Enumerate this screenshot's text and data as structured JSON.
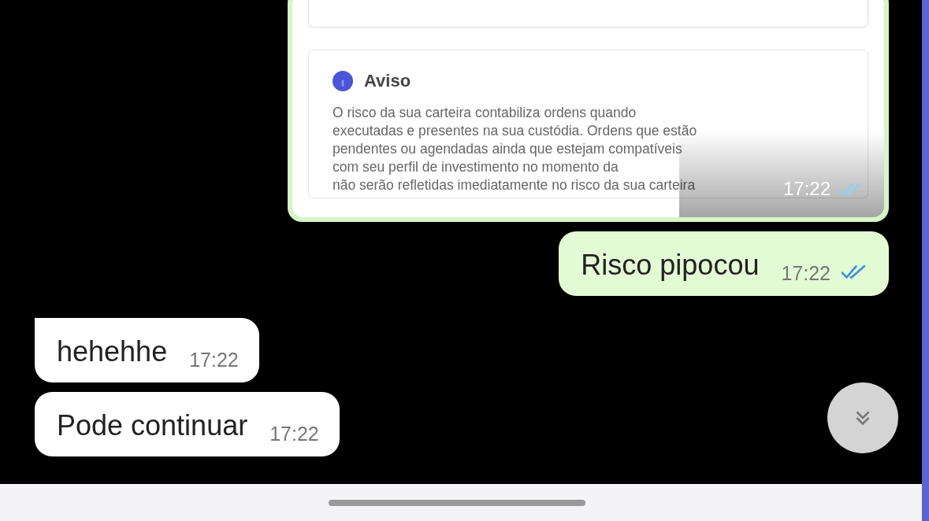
{
  "messages": [
    {
      "kind": "image",
      "outgoing": true,
      "notice": {
        "title": "Aviso",
        "lines": [
          "O risco da sua carteira contabiliza ordens quando",
          "executadas e presentes na sua custódia. Ordens que estão",
          "pendentes ou agendadas ainda que estejam compatíveis",
          "com seu perfil de investimento no momento da",
          "não serão refletidas imediatamente no risco da sua carteira"
        ]
      },
      "time": "17:22",
      "read": true
    },
    {
      "kind": "text",
      "outgoing": true,
      "text": "Risco pipocou",
      "time": "17:22",
      "read": true
    },
    {
      "kind": "text",
      "outgoing": false,
      "tail": true,
      "text": "hehehhe",
      "time": "17:22"
    },
    {
      "kind": "text",
      "outgoing": false,
      "tail": false,
      "text": "Pode continuar",
      "time": "17:22"
    }
  ]
}
